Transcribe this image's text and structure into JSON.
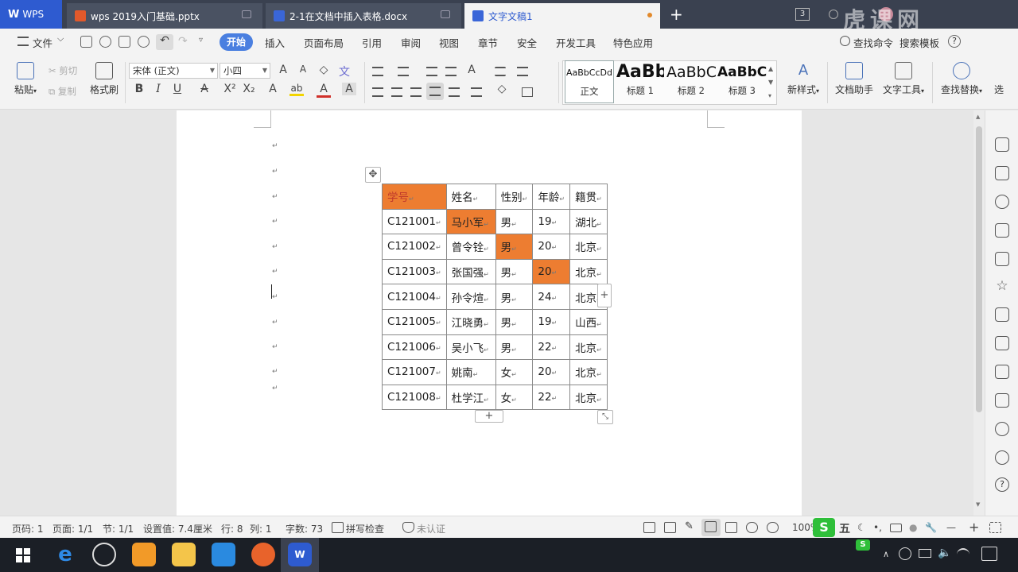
{
  "tabs": [
    {
      "label": "WPS",
      "color": "#3a66d8"
    },
    {
      "label": "wps 2019入门基础.pptx",
      "color": "#e2592b"
    },
    {
      "label": "2-1在文档中插入表格.docx",
      "color": "#3a66d8"
    },
    {
      "label": "文字文稿1",
      "color": "#3a66d8"
    }
  ],
  "tab_new": "+",
  "tab_count": "3",
  "watermark": "虎课网",
  "menu": {
    "file": "文件",
    "items": [
      "开始",
      "插入",
      "页面布局",
      "引用",
      "审阅",
      "视图",
      "章节",
      "安全",
      "开发工具",
      "特色应用"
    ],
    "search": "查找命令",
    "search2": "搜索模板"
  },
  "ribbon": {
    "paste": "粘贴",
    "cut": "剪切",
    "copy": "复制",
    "format_painter": "格式刷",
    "font_name": "宋体 (正文)",
    "font_size": "小四",
    "styles": [
      {
        "sample": "AaBbCcDd",
        "name": "正文"
      },
      {
        "sample": "AaBb",
        "name": "标题 1"
      },
      {
        "sample": "AaBbC",
        "name": "标题 2"
      },
      {
        "sample": "AaBbC",
        "name": "标题 3"
      }
    ],
    "new_style": "新样式",
    "doc_assistant": "文档助手",
    "text_tools": "文字工具",
    "find_replace": "查找替换",
    "select": "选"
  },
  "table": {
    "headers": [
      "学号",
      "姓名",
      "性别",
      "年龄",
      "籍贯"
    ],
    "rows": [
      [
        "C121001",
        "马小军",
        "男",
        "19",
        "湖北"
      ],
      [
        "C121002",
        "曾令铨",
        "男",
        "20",
        "北京"
      ],
      [
        "C121003",
        "张国强",
        "男",
        "20",
        "北京"
      ],
      [
        "C121004",
        "孙令煊",
        "男",
        "24",
        "北京"
      ],
      [
        "C121005",
        "江晓勇",
        "男",
        "19",
        "山西"
      ],
      [
        "C121006",
        "吴小飞",
        "男",
        "22",
        "北京"
      ],
      [
        "C121007",
        "姚南",
        "女",
        "20",
        "北京"
      ],
      [
        "C121008",
        "杜学江",
        "女",
        "22",
        "北京"
      ]
    ],
    "highlight_color": "#ed7d31"
  },
  "status": {
    "page_num": "页码: 1",
    "pages": "页面: 1/1",
    "section": "节: 1/1",
    "setting": "设置值: 7.4厘米",
    "row": "行: 8",
    "col": "列: 1",
    "words": "字数: 73",
    "spell": "拼写检查",
    "cert": "未认证",
    "zoom": "100%"
  },
  "ime": {
    "label": "五"
  }
}
